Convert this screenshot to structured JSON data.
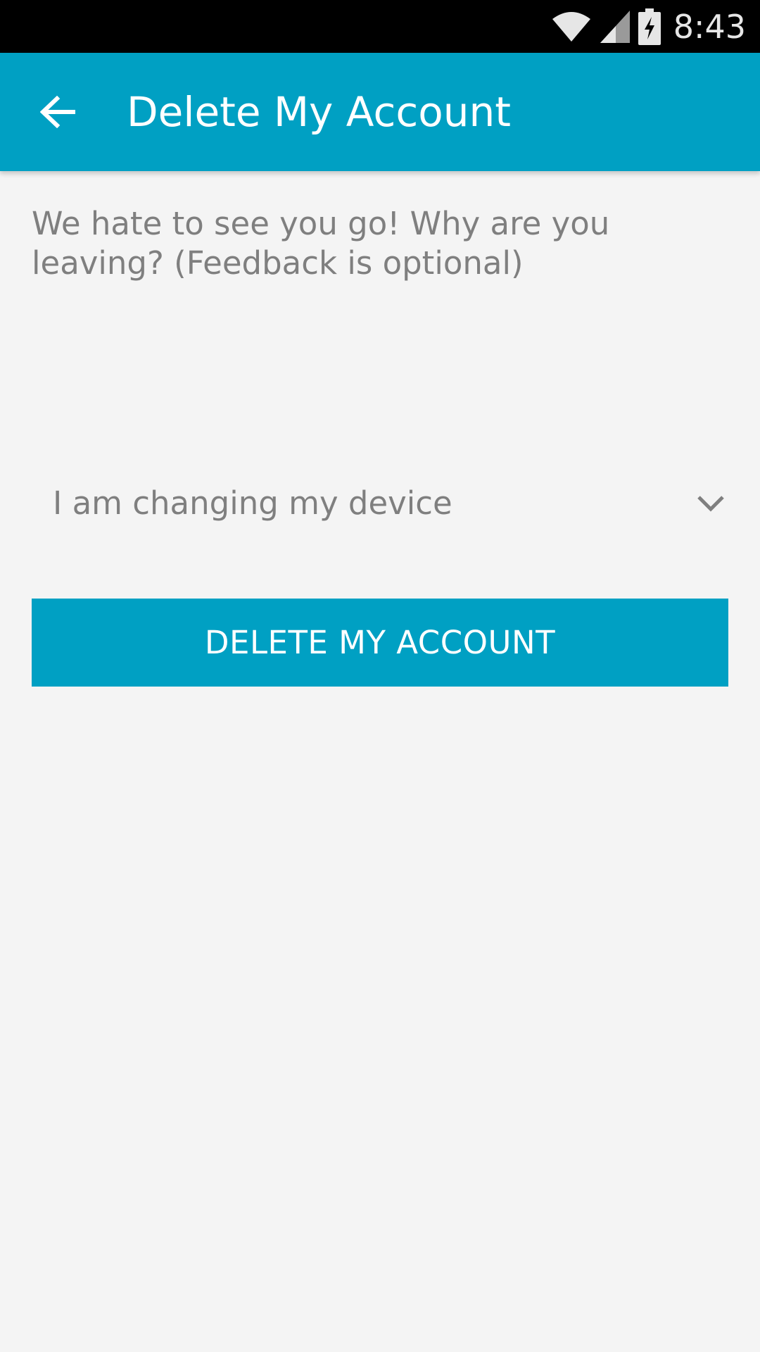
{
  "status_bar": {
    "time": "8:43",
    "icons": [
      "wifi-icon",
      "cell-signal-icon",
      "battery-charging-icon"
    ]
  },
  "app_bar": {
    "title": "Delete My Account",
    "back_icon": "arrow-left-icon"
  },
  "content": {
    "prompt": "We hate to see you go! Why are you leaving? (Feedback is optional)",
    "reason_selected": "I am changing my device",
    "dropdown_icon": "chevron-down-icon",
    "delete_button_label": "DELETE MY ACCOUNT"
  },
  "colors": {
    "primary": "#00a0c3",
    "background": "#f4f4f4",
    "text_secondary": "#7f7f7f",
    "status_bar": "#000000"
  }
}
